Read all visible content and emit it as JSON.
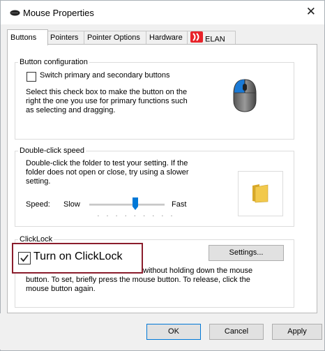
{
  "window": {
    "title": "Mouse Properties",
    "close_glyph": "✕",
    "icon": "mouse-icon"
  },
  "tabs": [
    {
      "label": "Buttons",
      "active": true
    },
    {
      "label": "Pointers"
    },
    {
      "label": "Pointer Options"
    },
    {
      "label": "Hardware"
    },
    {
      "label": "ELAN",
      "icon": "elan-logo-icon"
    }
  ],
  "button_configuration": {
    "legend": "Button configuration",
    "switch_label": "Switch primary and secondary buttons",
    "switch_checked": false,
    "description": [
      "Select this check box to make the button on the",
      "right the one you use for primary functions such",
      "as selecting and dragging."
    ],
    "illustration": "mouse-illustration-icon"
  },
  "double_click": {
    "legend": "Double-click speed",
    "description": [
      "Double-click the folder to test your setting. If the",
      "folder does not open or close, try using a slower",
      "setting."
    ],
    "speed_label": "Speed:",
    "slow_label": "Slow",
    "fast_label": "Fast",
    "speed_value_fraction": 0.6,
    "test_folder": "folder-icon"
  },
  "clicklock": {
    "legend": "ClickLock",
    "toggle_label": "Turn on ClickLock",
    "toggle_checked": true,
    "settings_label": "Settings...",
    "description_line1": "without holding down the mouse",
    "description_rest": [
      "button. To set, briefly press the mouse button. To release, click the",
      "mouse button again."
    ],
    "highlight_color": "#8b1d2c"
  },
  "footer": {
    "ok_label": "OK",
    "cancel_label": "Cancel",
    "apply_label": "Apply"
  },
  "colors": {
    "accent": "#0078d7",
    "mouse_blue": "#1a7ad6",
    "folder_yellow": "#f2c94c"
  }
}
